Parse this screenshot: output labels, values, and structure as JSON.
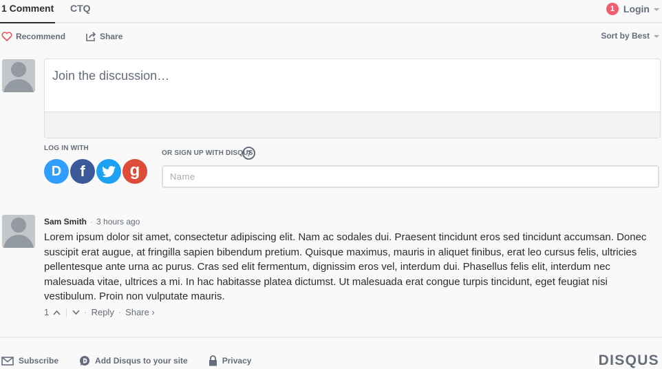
{
  "nav": {
    "tabs": [
      {
        "label": "1 Comment"
      },
      {
        "label": "CTQ"
      }
    ],
    "notification_count": "1",
    "login_label": "Login"
  },
  "actions": {
    "recommend_label": "Recommend",
    "share_label": "Share",
    "sort_label": "Sort by Best"
  },
  "composer": {
    "placeholder": "Join the discussion…",
    "login_with_label": "LOG IN WITH",
    "signup_label": "OR SIGN UP WITH DISQUS",
    "help_glyph": "?",
    "name_placeholder": "Name",
    "social": [
      {
        "icon": "disqus-icon",
        "glyph": "D",
        "color": "#2e9fff"
      },
      {
        "icon": "facebook-icon",
        "glyph": "f",
        "color": "#3b5998"
      },
      {
        "icon": "twitter-icon",
        "glyph": "",
        "color": "#1da1f2"
      },
      {
        "icon": "google-icon",
        "glyph": "g",
        "color": "#dd4b39"
      }
    ]
  },
  "comment": {
    "author": "Sam Smith",
    "time": "3 hours ago",
    "text": "Lorem ipsum dolor sit amet, consectetur adipiscing elit. Nam ac sodales dui. Praesent tincidunt eros sed tincidunt accumsan. Donec suscipit erat augue, at fringilla sapien bibendum pretium. Quisque maximus, mauris in aliquet finibus, erat leo cursus felis, ultricies pellentesque ante urna ac purus. Cras sed elit fermentum, dignissim eros vel, interdum dui. Phasellus felis elit, interdum nec malesuada vitae, ultrices a mi. In hac habitasse platea dictumst. Ut malesuada erat congue turpis tincidunt, eget feugiat nisi vestibulum. Proin non vulputate mauris.",
    "votes": "1",
    "reply_label": "Reply",
    "share_label": "Share ›"
  },
  "footer": {
    "subscribe_label": "Subscribe",
    "add_disqus_label": "Add Disqus to your site",
    "privacy_label": "Privacy",
    "brand": "DISQUS"
  },
  "colors": {
    "accent_red": "#f05f70",
    "text_gray": "#656c7a"
  }
}
